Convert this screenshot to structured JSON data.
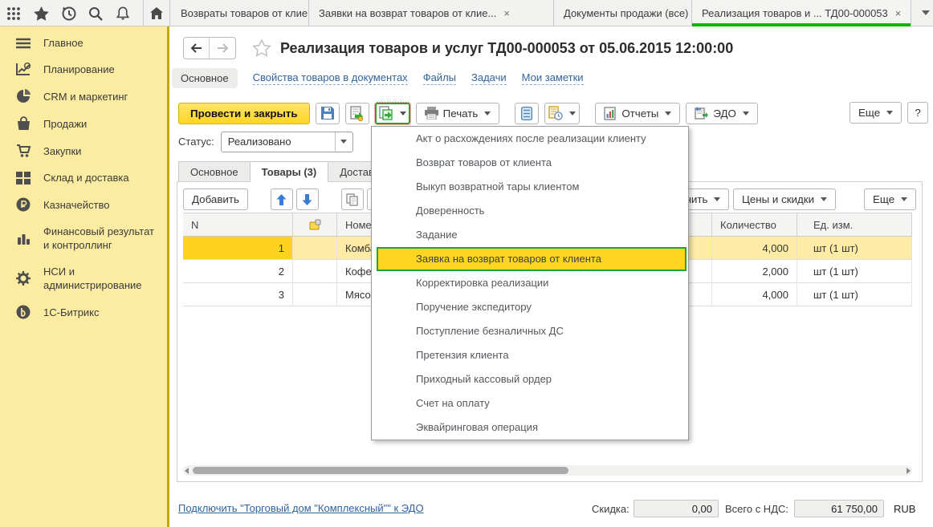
{
  "colors": {
    "sidebar_bg": "#fbeca1",
    "accent_green": "#17b00b",
    "selection_yellow": "#ffd21f",
    "menu_highlight_yellow": "#ffd61f",
    "menu_highlight_border": "#1ea33c",
    "link_blue": "#31639c",
    "primary_button_yellow": "#ffd625"
  },
  "topbar": {
    "close_glyph": "×",
    "tabs": [
      {
        "label": "Возвраты товаров от клиентов"
      },
      {
        "label": "Заявки на возврат товаров от клие..."
      },
      {
        "label": "Документы продажи (все)"
      },
      {
        "label": "Реализация товаров и ... ТД00-000053"
      }
    ]
  },
  "sidebar": {
    "items": [
      {
        "label": "Главное",
        "icon": "menu-icon"
      },
      {
        "label": "Планирование",
        "icon": "planning-chart-icon"
      },
      {
        "label": "CRM и маркетинг",
        "icon": "pie-chart-icon"
      },
      {
        "label": "Продажи",
        "icon": "shopping-bag-icon"
      },
      {
        "label": "Закупки",
        "icon": "shopping-cart-icon"
      },
      {
        "label": "Склад и доставка",
        "icon": "warehouse-grid-icon"
      },
      {
        "label": "Казначейство",
        "icon": "ruble-coin-icon"
      },
      {
        "label": "Финансовый результат и контроллинг",
        "icon": "bar-chart-icon"
      },
      {
        "label": "НСИ и администрирование",
        "icon": "gear-icon"
      },
      {
        "label": "1С-Битрикс",
        "icon": "bitrix-icon"
      }
    ]
  },
  "doc": {
    "title": "Реализация товаров и услуг ТД00-000053 от 05.06.2015 12:00:00",
    "nav": {
      "main": "Основное",
      "links": [
        "Свойства товаров в документах",
        "Файлы",
        "Задачи",
        "Мои заметки"
      ]
    },
    "toolbar": {
      "post_close": "Провести и закрыть",
      "print": "Печать",
      "reports": "Отчеты",
      "edo": "ЭДО",
      "more": "Еще",
      "help": "?"
    },
    "status": {
      "label": "Статус:",
      "value": "Реализовано"
    },
    "tabs": [
      "Основное",
      "Товары (3)",
      "Доставка"
    ],
    "table_toolbar": {
      "add": "Добавить",
      "fill": "Заполнить",
      "prices": "Цены и скидки",
      "more": "Еще"
    },
    "table": {
      "headers": {
        "n": "N",
        "name": "Номенклатура",
        "qty": "Количество",
        "unit": "Ед. изм."
      },
      "rows": [
        {
          "n": "1",
          "name": "Комба",
          "qty": "4,000",
          "unit": "шт (1 шт)"
        },
        {
          "n": "2",
          "name": "Кофев",
          "qty": "2,000",
          "unit": "шт (1 шт)"
        },
        {
          "n": "3",
          "name": "Мясор",
          "qty": "4,000",
          "unit": "шт (1 шт)"
        }
      ]
    },
    "footer": {
      "edo_link": "Подключить \"Торговый дом \"Комплексный\"\" к ЭДО",
      "discount_label": "Скидка:",
      "discount_value": "0,00",
      "total_label": "Всего с НДС:",
      "total_value": "61 750,00",
      "currency": "RUB"
    }
  },
  "menu": {
    "items": [
      "Акт о расхождениях после реализации клиенту",
      "Возврат товаров от клиента",
      "Выкуп возвратной тары клиентом",
      "Доверенность",
      "Задание",
      "Заявка на возврат товаров от клиента",
      "Корректировка реализации",
      "Поручение экспедитору",
      "Поступление безналичных ДС",
      "Претензия клиента",
      "Приходный кассовый ордер",
      "Счет на оплату",
      "Эквайринговая операция"
    ],
    "highlighted_index": 5
  }
}
